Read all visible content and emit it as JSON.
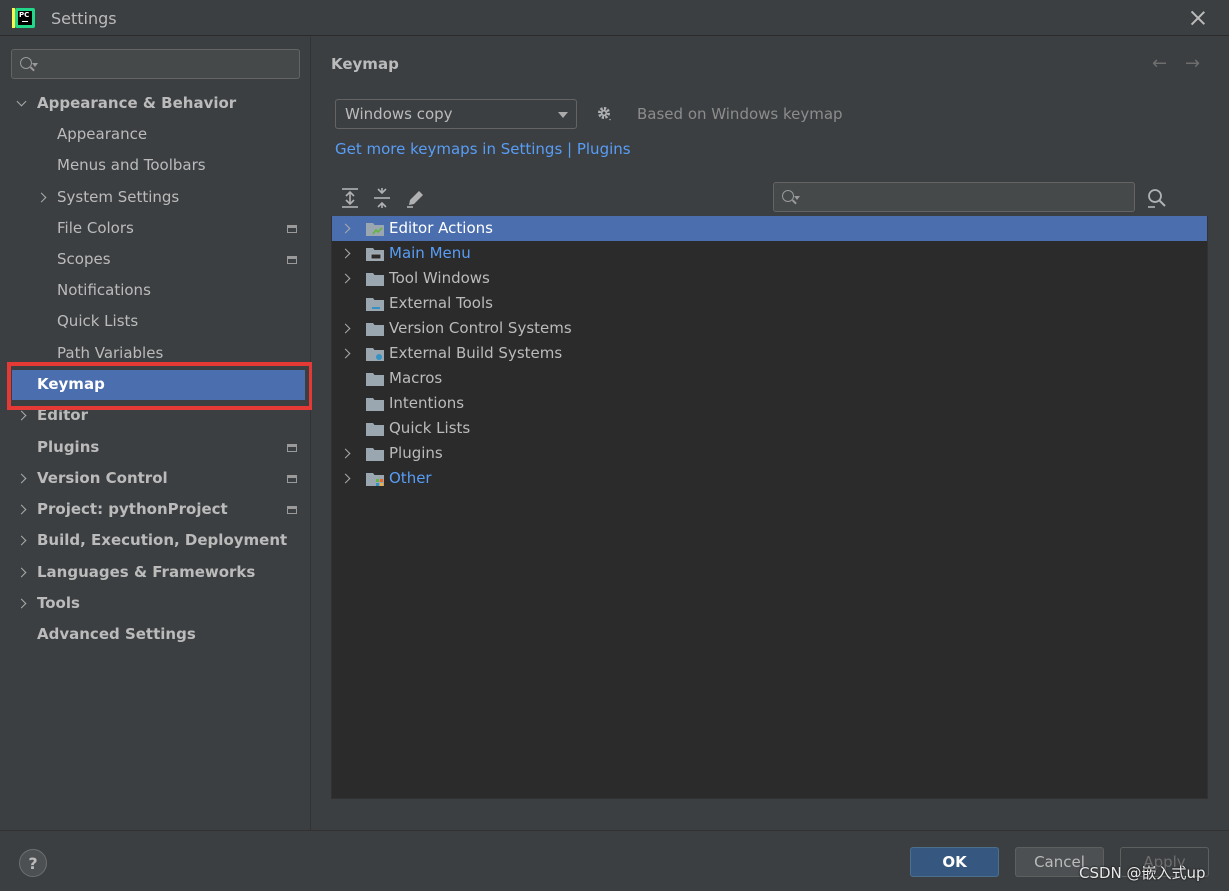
{
  "window": {
    "title": "Settings"
  },
  "sidebar": {
    "search_placeholder": "",
    "items": [
      {
        "label": "Appearance & Behavior",
        "bold": true,
        "expand": "down",
        "indent": 0
      },
      {
        "label": "Appearance",
        "bold": false,
        "expand": "none",
        "indent": 1
      },
      {
        "label": "Menus and Toolbars",
        "bold": false,
        "expand": "none",
        "indent": 1
      },
      {
        "label": "System Settings",
        "bold": false,
        "expand": "right",
        "indent": 1
      },
      {
        "label": "File Colors",
        "bold": false,
        "expand": "none",
        "indent": 1,
        "project": true
      },
      {
        "label": "Scopes",
        "bold": false,
        "expand": "none",
        "indent": 1,
        "project": true
      },
      {
        "label": "Notifications",
        "bold": false,
        "expand": "none",
        "indent": 1
      },
      {
        "label": "Quick Lists",
        "bold": false,
        "expand": "none",
        "indent": 1
      },
      {
        "label": "Path Variables",
        "bold": false,
        "expand": "none",
        "indent": 1
      },
      {
        "label": "Keymap",
        "bold": true,
        "expand": "none",
        "indent": 0,
        "selected": true
      },
      {
        "label": "Editor",
        "bold": true,
        "expand": "right",
        "indent": 0
      },
      {
        "label": "Plugins",
        "bold": true,
        "expand": "none",
        "indent": 0,
        "project": true
      },
      {
        "label": "Version Control",
        "bold": true,
        "expand": "right",
        "indent": 0,
        "project": true
      },
      {
        "label": "Project: pythonProject",
        "bold": true,
        "expand": "right",
        "indent": 0,
        "project": true
      },
      {
        "label": "Build, Execution, Deployment",
        "bold": true,
        "expand": "right",
        "indent": 0
      },
      {
        "label": "Languages & Frameworks",
        "bold": true,
        "expand": "right",
        "indent": 0
      },
      {
        "label": "Tools",
        "bold": true,
        "expand": "right",
        "indent": 0
      },
      {
        "label": "Advanced Settings",
        "bold": true,
        "expand": "none",
        "indent": 0
      }
    ]
  },
  "main": {
    "title": "Keymap",
    "back_arrow": "←",
    "forward_arrow": "→",
    "keymap_combo": "Windows copy",
    "based_on": "Based on Windows keymap",
    "link_text": "Get more keymaps in Settings | Plugins",
    "search_placeholder": "",
    "tree": [
      {
        "label": "Editor Actions",
        "expandable": true,
        "selected": true,
        "icon": "editor-actions-folder-icon",
        "blue": false
      },
      {
        "label": "Main Menu",
        "expandable": true,
        "selected": false,
        "icon": "main-menu-folder-icon",
        "blue": true
      },
      {
        "label": "Tool Windows",
        "expandable": true,
        "selected": false,
        "icon": "folder-icon",
        "blue": false
      },
      {
        "label": "External Tools",
        "expandable": false,
        "selected": false,
        "icon": "external-tools-folder-icon",
        "blue": false
      },
      {
        "label": "Version Control Systems",
        "expandable": true,
        "selected": false,
        "icon": "folder-icon",
        "blue": false
      },
      {
        "label": "External Build Systems",
        "expandable": true,
        "selected": false,
        "icon": "build-systems-folder-icon",
        "blue": false
      },
      {
        "label": "Macros",
        "expandable": false,
        "selected": false,
        "icon": "folder-icon",
        "blue": false
      },
      {
        "label": "Intentions",
        "expandable": false,
        "selected": false,
        "icon": "folder-icon",
        "blue": false
      },
      {
        "label": "Quick Lists",
        "expandable": false,
        "selected": false,
        "icon": "folder-icon",
        "blue": false
      },
      {
        "label": "Plugins",
        "expandable": true,
        "selected": false,
        "icon": "folder-icon",
        "blue": false
      },
      {
        "label": "Other",
        "expandable": true,
        "selected": false,
        "icon": "other-folder-icon",
        "blue": true
      }
    ]
  },
  "footer": {
    "help": "?",
    "ok": "OK",
    "cancel": "Cancel",
    "apply": "Apply"
  },
  "watermark": "CSDN @嵌入式up",
  "colors": {
    "background": "#3c3f41",
    "selection": "#4b6eaf",
    "link": "#589df6",
    "highlight": "#e53935",
    "ok_button": "#365880"
  }
}
